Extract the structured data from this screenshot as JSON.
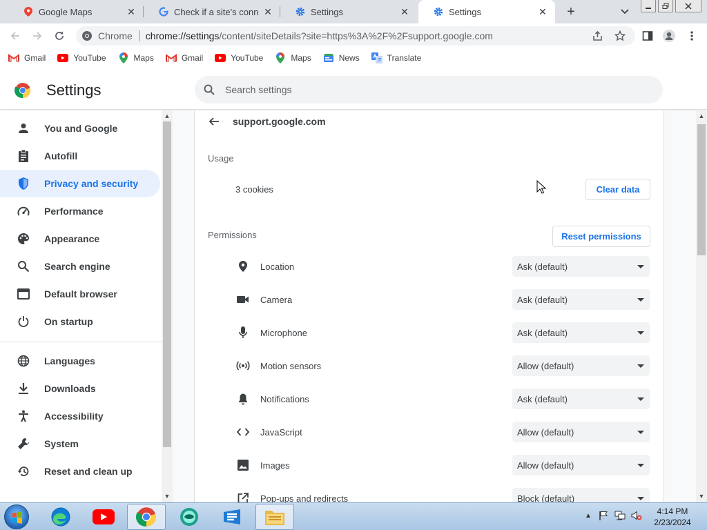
{
  "tabs": [
    {
      "title": "Google Maps",
      "icon": "maps-pin-icon"
    },
    {
      "title": "Check if a site's connection is secure",
      "icon": "google-g-icon"
    },
    {
      "title": "Settings",
      "icon": "settings-gear-icon"
    },
    {
      "title": "Settings",
      "icon": "settings-gear-icon",
      "active": true
    }
  ],
  "omnibox": {
    "chip": "Chrome",
    "url_host": "chrome://settings",
    "url_path": "/content/siteDetails?site=https%3A%2F%2Fsupport.google.com"
  },
  "bookmarks": [
    {
      "label": "Gmail",
      "icon": "gmail-icon"
    },
    {
      "label": "YouTube",
      "icon": "youtube-icon"
    },
    {
      "label": "Maps",
      "icon": "maps-pin-icon"
    },
    {
      "label": "Gmail",
      "icon": "gmail-icon"
    },
    {
      "label": "YouTube",
      "icon": "youtube-icon"
    },
    {
      "label": "Maps",
      "icon": "maps-pin-icon"
    },
    {
      "label": "News",
      "icon": "news-icon"
    },
    {
      "label": "Translate",
      "icon": "translate-icon"
    }
  ],
  "header": {
    "title": "Settings",
    "search_placeholder": "Search settings"
  },
  "sidebar": {
    "items": [
      {
        "label": "You and Google",
        "icon": "person-icon"
      },
      {
        "label": "Autofill",
        "icon": "clipboard-icon"
      },
      {
        "label": "Privacy and security",
        "icon": "shield-icon",
        "active": true
      },
      {
        "label": "Performance",
        "icon": "speedometer-icon"
      },
      {
        "label": "Appearance",
        "icon": "palette-icon"
      },
      {
        "label": "Search engine",
        "icon": "search-icon"
      },
      {
        "label": "Default browser",
        "icon": "browser-window-icon"
      },
      {
        "label": "On startup",
        "icon": "power-icon"
      },
      {
        "label": "Languages",
        "icon": "globe-icon"
      },
      {
        "label": "Downloads",
        "icon": "download-icon"
      },
      {
        "label": "Accessibility",
        "icon": "accessibility-icon"
      },
      {
        "label": "System",
        "icon": "wrench-icon"
      },
      {
        "label": "Reset and clean up",
        "icon": "restore-icon"
      }
    ]
  },
  "site": {
    "name": "support.google.com",
    "usage_label": "Usage",
    "cookies": "3 cookies",
    "clear_data": "Clear data",
    "permissions_label": "Permissions",
    "reset_permissions": "Reset permissions",
    "permissions": [
      {
        "label": "Location",
        "value": "Ask (default)",
        "icon": "location-pin-icon"
      },
      {
        "label": "Camera",
        "value": "Ask (default)",
        "icon": "camera-icon"
      },
      {
        "label": "Microphone",
        "value": "Ask (default)",
        "icon": "microphone-icon"
      },
      {
        "label": "Motion sensors",
        "value": "Allow (default)",
        "icon": "motion-sensor-icon"
      },
      {
        "label": "Notifications",
        "value": "Ask (default)",
        "icon": "bell-icon"
      },
      {
        "label": "JavaScript",
        "value": "Allow (default)",
        "icon": "code-icon"
      },
      {
        "label": "Images",
        "value": "Allow (default)",
        "icon": "image-icon"
      },
      {
        "label": "Pop-ups and redirects",
        "value": "Block (default)",
        "icon": "popup-icon"
      }
    ]
  },
  "taskbar": {
    "time": "4:14 PM",
    "date": "2/23/2024",
    "apps": [
      "edge-icon",
      "youtube-icon",
      "chrome-icon",
      "app-icon",
      "app-icon",
      "file-explorer-icon"
    ]
  },
  "colors": {
    "accent": "#1a73e8",
    "active_nav_bg": "#e8f0fe",
    "tab_strip": "#dee1e6"
  }
}
